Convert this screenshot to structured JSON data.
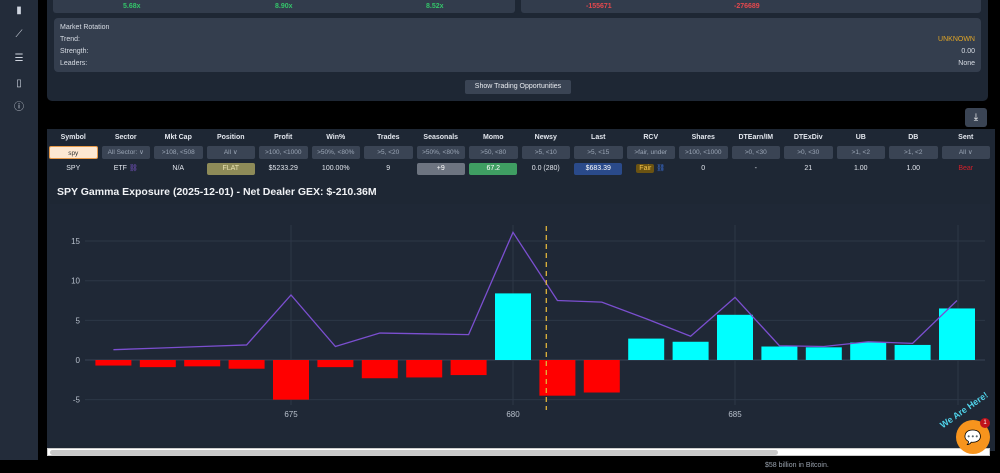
{
  "sidebar": {
    "icons": [
      "bar-chart-icon",
      "line-chart-icon",
      "sliders-icon",
      "book-icon",
      "info-icon"
    ]
  },
  "stats": {
    "values": [
      {
        "text": "5.68x",
        "color": "#34c46a"
      },
      {
        "text": "8.90x",
        "color": "#34c46a"
      },
      {
        "text": "8.52x",
        "color": "#34c46a"
      },
      {
        "text": "-155671",
        "color": "#e5484d"
      },
      {
        "text": "-276689",
        "color": "#e5484d"
      }
    ]
  },
  "rotation": {
    "title": "Market Rotation",
    "trend_label": "Trend:",
    "trend_value": "UNKNOWN",
    "strength_label": "Strength:",
    "strength_value": "0.00",
    "leaders_label": "Leaders:",
    "leaders_value": "None",
    "trend_color": "#e0a526"
  },
  "show_button": "Show Trading Opportunities",
  "table": {
    "headers": [
      "Symbol",
      "Sector",
      "Mkt Cap",
      "Position",
      "Profit",
      "Win%",
      "Trades",
      "Seasonals",
      "Momo",
      "Newsy",
      "Last",
      "RCV",
      "Shares",
      "DTEarn/IM",
      "DTExDiv",
      "UB",
      "DB",
      "Sent"
    ],
    "filters": [
      "spy",
      "All Sector: ∨",
      ">108, <508",
      "All ∨",
      ">100, <1000",
      ">50%, <80%",
      ">5, <20",
      ">50%, <80%",
      ">50, <80",
      ">5, <10",
      ">5, <15",
      ">fair, under",
      ">100, <1000",
      ">0, <30",
      ">0, <30",
      ">1, <2",
      ">1, <2",
      "All ∨"
    ],
    "row": [
      "SPY",
      "ETF",
      "N/A",
      "FLAT",
      "$5233.29",
      "100.00%",
      "9",
      "+9",
      "67.2",
      "0.0 (280)",
      "$683.39",
      "Fair",
      "0",
      "-",
      "21",
      "1.00",
      "1.00",
      "Bear"
    ]
  },
  "chart_data": {
    "type": "bar",
    "title": "SPY Gamma Exposure (2025-12-01) - Net Dealer GEX: $-210.36M",
    "x": [
      671,
      672,
      673,
      674,
      675,
      676,
      677,
      678,
      679,
      680,
      681,
      682,
      683,
      684,
      685,
      686,
      687,
      688,
      689,
      690
    ],
    "series": [
      {
        "name": "Net GEX",
        "type": "bar",
        "values": [
          -0.7,
          -0.9,
          -0.8,
          -1.1,
          -5.0,
          -0.9,
          -2.3,
          -2.2,
          -1.9,
          8.4,
          -4.5,
          -4.1,
          2.7,
          2.3,
          5.7,
          1.7,
          1.6,
          2.2,
          1.9,
          6.5
        ],
        "pos_color": "#00ffff",
        "neg_color": "#ff0000"
      },
      {
        "name": "Total GEX",
        "type": "line",
        "values": [
          1.3,
          1.5,
          1.7,
          1.9,
          8.2,
          1.7,
          3.4,
          3.3,
          3.2,
          16.1,
          7.5,
          7.3,
          5.2,
          3.0,
          7.9,
          1.8,
          1.7,
          2.3,
          2.1,
          7.5
        ],
        "color": "#7b4fd0"
      }
    ],
    "spot_line": 680.75,
    "xticks": [
      675,
      680,
      685
    ],
    "yticks": [
      -5,
      0,
      5,
      10,
      15
    ],
    "xlim": [
      670.3,
      690.8
    ],
    "ylim": [
      -6,
      17
    ]
  },
  "chat": {
    "label": "We Are Here!",
    "badge": "1"
  },
  "bottom": {
    "news": "$58 billion in Bitcoin."
  }
}
